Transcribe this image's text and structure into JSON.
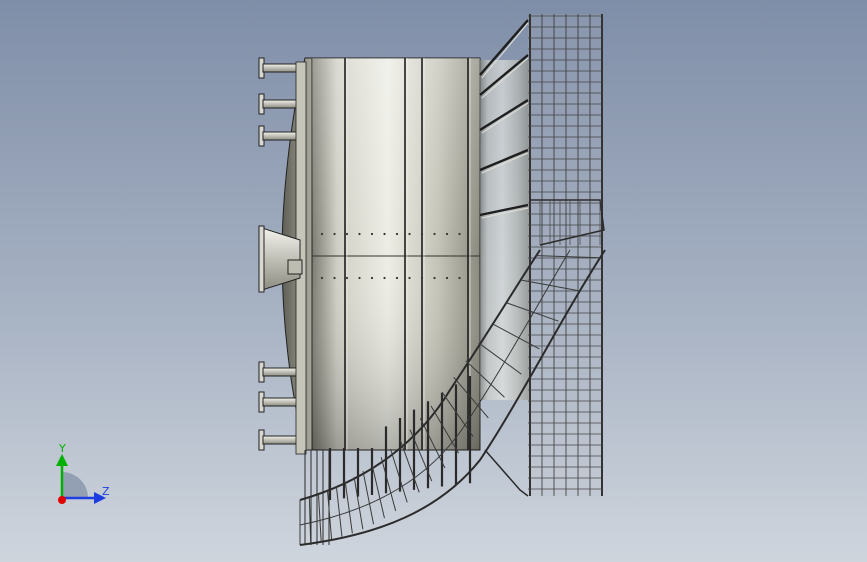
{
  "viewport": {
    "background_top": "#7f8ea8",
    "background_bottom": "#cfd5dd"
  },
  "model": {
    "colors": {
      "shell_light": "#e9e9e1",
      "shell_mid": "#b9b9ad",
      "shell_dark": "#6f6f66",
      "edge": "#202020",
      "walkway": "#3a3a3a",
      "walkway_fill": "#c9c9c0"
    }
  },
  "triad": {
    "y_label": "Y",
    "z_label": "Z",
    "colors": {
      "y_axis": "#00b000",
      "z_axis": "#1d3de0",
      "x_axis": "#e00000",
      "quadrant": "#8e9bb0"
    }
  }
}
